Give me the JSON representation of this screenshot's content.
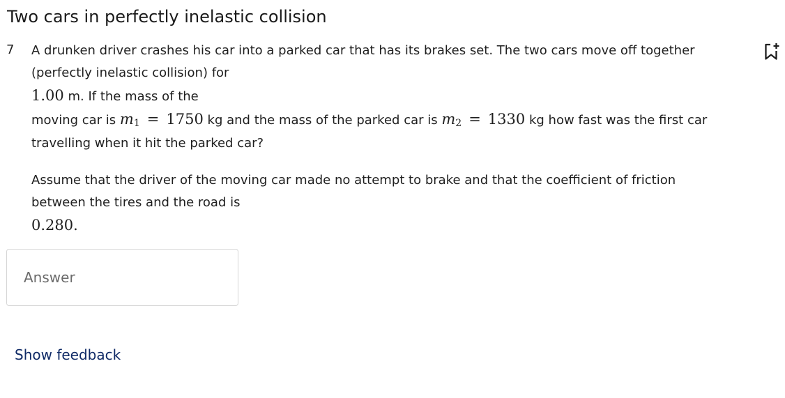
{
  "page_title": "Two cars in perfectly inelastic collision",
  "question": {
    "number": "7",
    "line1": "A drunken driver crashes his car into a parked car that has its brakes set. The two cars move off together",
    "line2": "(perfectly inelastic collision) for",
    "distance_value": "1.00",
    "distance_suffix": " m. If the mass of the",
    "line4_prefix": "moving car is ",
    "m1_symbol": "m",
    "m1_index": "1",
    "equals": "=",
    "m1_value": "1750",
    "line4_middle": " kg and the mass of the parked car is ",
    "m2_symbol": "m",
    "m2_index": "2",
    "m2_value": "1330",
    "line4_suffix": " kg how fast was the first car",
    "line5": "travelling when it hit the parked car?",
    "para2_line1": "Assume that the driver of the moving car made no attempt to brake and that the coefficient of friction",
    "para2_line2": "between the tires and the road is",
    "friction_value": "0.280."
  },
  "answer": {
    "placeholder": "Answer",
    "value": ""
  },
  "show_feedback_label": "Show feedback",
  "icons": {
    "bookmark": "bookmark-add-icon"
  },
  "colors": {
    "link": "#0f2a66",
    "border": "#d6d6d6",
    "text": "#1f1f1f"
  }
}
